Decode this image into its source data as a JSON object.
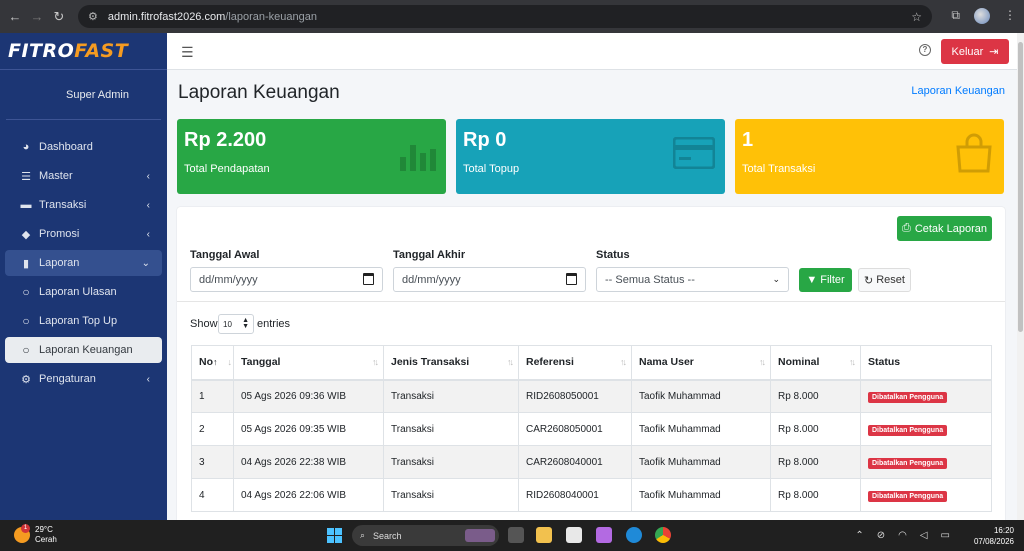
{
  "browser": {
    "url_host": "admin.fitrofast2026.com",
    "url_path": "/laporan-keuangan"
  },
  "brand": {
    "part1": "FITRO",
    "part2": "FAST"
  },
  "user": {
    "name": "Super Admin"
  },
  "sidebar": {
    "items": [
      {
        "label": "Dashboard",
        "icon": "gauge-icon"
      },
      {
        "label": "Master",
        "icon": "database-icon"
      },
      {
        "label": "Transaksi",
        "icon": "money-icon"
      },
      {
        "label": "Promosi",
        "icon": "tag-icon"
      },
      {
        "label": "Laporan",
        "icon": "book-icon"
      },
      {
        "label": "Laporan Ulasan",
        "icon": "circle-icon"
      },
      {
        "label": "Laporan Top Up",
        "icon": "circle-icon"
      },
      {
        "label": "Laporan Keuangan",
        "icon": "circle-icon"
      },
      {
        "label": "Pengaturan",
        "icon": "gear-icon"
      }
    ]
  },
  "topbar": {
    "logout_label": "Keluar"
  },
  "page": {
    "title": "Laporan Keuangan",
    "breadcrumb": "Laporan Keuangan"
  },
  "stats": [
    {
      "value": "Rp 2.200",
      "label": "Total Pendapatan",
      "color": "#28a745"
    },
    {
      "value": "Rp 0",
      "label": "Total Topup",
      "color": "#17a2b8"
    },
    {
      "value": "1",
      "label": "Total Transaksi",
      "color": "#ffc107"
    }
  ],
  "filters": {
    "print_label": "Cetak Laporan",
    "start_label": "Tanggal Awal",
    "start_placeholder": "dd/mm/yyyy",
    "end_label": "Tanggal Akhir",
    "end_placeholder": "dd/mm/yyyy",
    "status_label": "Status",
    "status_value": "-- Semua Status --",
    "filter_label": "Filter",
    "reset_label": "Reset"
  },
  "table": {
    "show_label": "Show",
    "length_value": "10",
    "entries_label": "entries",
    "headers": [
      "No",
      "Tanggal",
      "Jenis Transaksi",
      "Referensi",
      "Nama User",
      "Nominal",
      "Status"
    ],
    "rows": [
      {
        "no": "1",
        "tanggal": "05 Ags 2026 09:36 WIB",
        "jenis": "Transaksi",
        "ref": "RID2608050001",
        "user": "Taofik Muhammad",
        "nominal": "Rp 8.000",
        "status": "Dibatalkan Pengguna"
      },
      {
        "no": "2",
        "tanggal": "05 Ags 2026 09:35 WIB",
        "jenis": "Transaksi",
        "ref": "CAR2608050001",
        "user": "Taofik Muhammad",
        "nominal": "Rp 8.000",
        "status": "Dibatalkan Pengguna"
      },
      {
        "no": "3",
        "tanggal": "04 Ags 2026 22:38 WIB",
        "jenis": "Transaksi",
        "ref": "CAR2608040001",
        "user": "Taofik Muhammad",
        "nominal": "Rp 8.000",
        "status": "Dibatalkan Pengguna"
      },
      {
        "no": "4",
        "tanggal": "04 Ags 2026 22:06 WIB",
        "jenis": "Transaksi",
        "ref": "RID2608040001",
        "user": "Taofik Muhammad",
        "nominal": "Rp 8.000",
        "status": "Dibatalkan Pengguna"
      }
    ]
  },
  "taskbar": {
    "temp": "29°C",
    "weather": "Cerah",
    "notif_count": "1",
    "search_label": "Search",
    "time": "16:20",
    "date": "07/08/2026"
  }
}
